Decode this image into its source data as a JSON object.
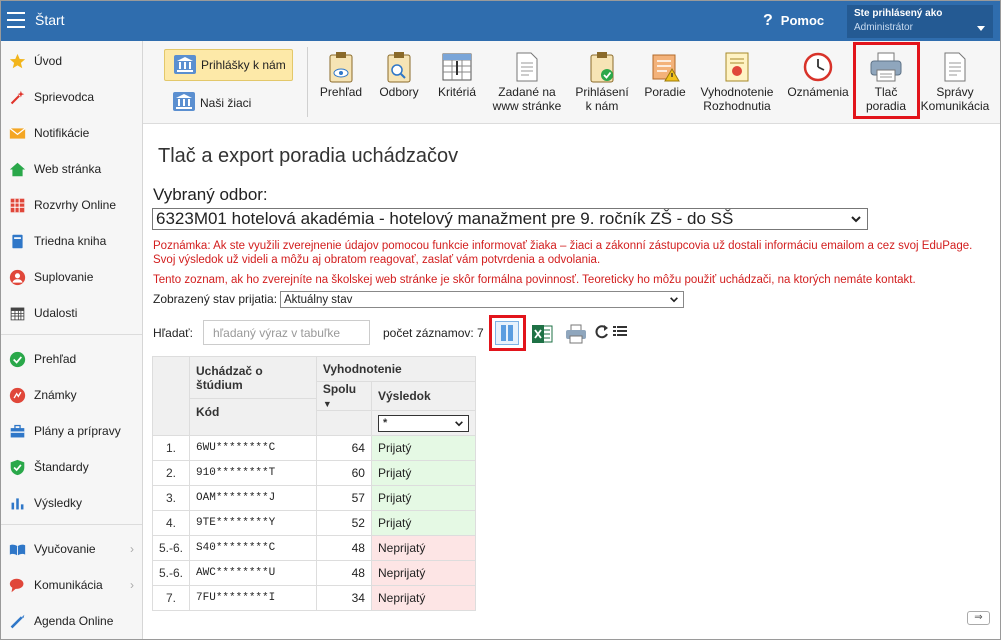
{
  "topbar": {
    "title": "Štart",
    "help_label": "Pomoc",
    "user_line1": "Ste prihlásený ako",
    "user_line2": "Administrátor"
  },
  "sidebar": {
    "items": [
      {
        "label": "Úvod",
        "icon": "star-icon"
      },
      {
        "label": "Sprievodca",
        "icon": "wand-icon"
      },
      {
        "label": "Notifikácie",
        "icon": "envelope-icon"
      },
      {
        "label": "Web stránka",
        "icon": "house-icon"
      },
      {
        "label": "Rozvrhy Online",
        "icon": "calendar-grid-icon"
      },
      {
        "label": "Triedna kniha",
        "icon": "book-icon"
      },
      {
        "label": "Suplovanie",
        "icon": "person-icon"
      },
      {
        "label": "Udalosti",
        "icon": "calendar-icon"
      },
      {
        "label": "Prehľad",
        "icon": "check-circle-icon"
      },
      {
        "label": "Známky",
        "icon": "grades-icon"
      },
      {
        "label": "Plány a prípravy",
        "icon": "briefcase-icon"
      },
      {
        "label": "Štandardy",
        "icon": "shield-check-icon"
      },
      {
        "label": "Výsledky",
        "icon": "bar-chart-icon"
      },
      {
        "label": "Vyučovanie",
        "icon": "open-book-icon"
      },
      {
        "label": "Komunikácia",
        "icon": "chat-icon"
      },
      {
        "label": "Agenda Online",
        "icon": "pen-icon"
      }
    ]
  },
  "toolbar": {
    "left1": "Prihlášky k nám",
    "left2": "Naši žiaci",
    "buttons": [
      {
        "l1": "Prehľad",
        "l2": ""
      },
      {
        "l1": "Odbory",
        "l2": ""
      },
      {
        "l1": "Kritériá",
        "l2": ""
      },
      {
        "l1": "Zadané na",
        "l2": "www stránke"
      },
      {
        "l1": "Prihlásení",
        "l2": "k nám"
      },
      {
        "l1": "Poradie",
        "l2": ""
      },
      {
        "l1": "Vyhodnotenie",
        "l2": "Rozhodnutia"
      },
      {
        "l1": "Oznámenia",
        "l2": ""
      },
      {
        "l1": "Tlač",
        "l2": "poradia"
      },
      {
        "l1": "Správy",
        "l2": "Komunikácia"
      }
    ]
  },
  "page": {
    "title": "Tlač a export poradia uchádzačov",
    "vybrany_label": "Vybraný odbor:",
    "odbor_value": "6323M01 hotelová akadémia - hotelový manažment pre 9. ročník ZŠ - do SŠ",
    "note1": "Poznámka: Ak ste využili zverejnenie údajov pomocou funkcie informovať žiaka – žiaci a zákonní zástupcovia už dostali informáciu emailom a cez svoj EduPage. Svoj výsledok už videli a môžu aj obratom reagovať, zaslať vám potvrdenia a odvolania.",
    "note2": "Tento zoznam, ak ho zverejníte na školskej web stránke je skôr formálna povinnosť. Teoreticky ho môžu použiť uchádzači, na ktorých nemáte kontakt.",
    "stav_label": "Zobrazený stav prijatia:",
    "stav_value": "Aktuálny stav",
    "search_label": "Hľadať:",
    "search_placeholder": "hľadaný výraz v tabuľke",
    "count_text": "počet záznamov: 7"
  },
  "table": {
    "group1": "Uchádzač o štúdium",
    "group2": "Vyhodnotenie",
    "col_kod": "Kód",
    "col_spolu": "Spolu",
    "col_vysledok": "Výsledok",
    "filter_value": "*",
    "rows": [
      {
        "rank": "1.",
        "code": "6WU********C",
        "total": "64",
        "result": "Prijatý"
      },
      {
        "rank": "2.",
        "code": "910********T",
        "total": "60",
        "result": "Prijatý"
      },
      {
        "rank": "3.",
        "code": "OAM********J",
        "total": "57",
        "result": "Prijatý"
      },
      {
        "rank": "4.",
        "code": "9TE********Y",
        "total": "52",
        "result": "Prijatý"
      },
      {
        "rank": "5.-6.",
        "code": "S40********C",
        "total": "48",
        "result": "Neprijatý"
      },
      {
        "rank": "5.-6.",
        "code": "AWC********U",
        "total": "48",
        "result": "Neprijatý"
      },
      {
        "rank": "7.",
        "code": "7FU********I",
        "total": "34",
        "result": "Neprijatý"
      }
    ]
  },
  "colors": {
    "topbar": "#2f6dae",
    "highlight": "#e2141b",
    "accepted": "#e5f9e4",
    "rejected": "#fde5e5",
    "note": "#d21e1e"
  }
}
